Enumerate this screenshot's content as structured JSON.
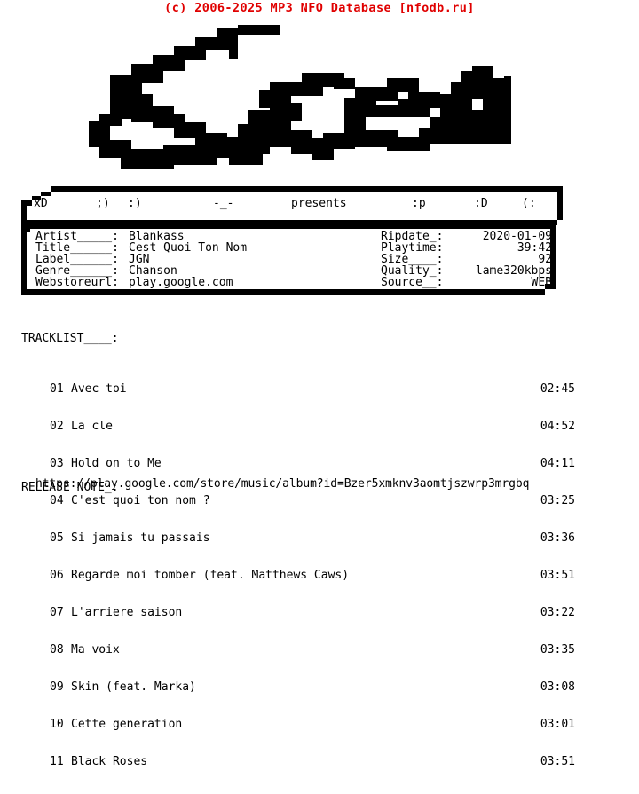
{
  "header": {
    "copyright": "(c) 2006-2025 MP3 NFO Database [nfodb.ru]",
    "copyright_color": "#e00000"
  },
  "logo": {
    "text": "Sceau",
    "style": "pixel-ascii-art",
    "color": "#000000"
  },
  "banner": {
    "slots": [
      "xD",
      ";)",
      ":)",
      "-_-",
      "presents",
      ":p",
      ":D",
      "(:"
    ]
  },
  "info": {
    "left": [
      {
        "key": "Artist_____:",
        "value": "Blankass"
      },
      {
        "key": "Title______:",
        "value": "Cest Quoi Ton Nom"
      },
      {
        "key": "Label______:",
        "value": "JGN"
      },
      {
        "key": "Genre______:",
        "value": "Chanson"
      },
      {
        "key": "Webstoreurl:",
        "value": "play.google.com"
      }
    ],
    "right": [
      {
        "key": "Ripdate_:",
        "value": "2020-01-09"
      },
      {
        "key": "Playtime:",
        "value": "39:42"
      },
      {
        "key": "Size____:",
        "value": "92"
      },
      {
        "key": "Quality_:",
        "value": "lame320kbps"
      },
      {
        "key": "Source__:",
        "value": "WEB"
      }
    ]
  },
  "tracklist": {
    "heading": "TRACKLIST____:",
    "tracks": [
      {
        "num": "01",
        "title": "Avec toi",
        "time": "02:45"
      },
      {
        "num": "02",
        "title": "La cle",
        "time": "04:52"
      },
      {
        "num": "03",
        "title": "Hold on to Me",
        "time": "04:11"
      },
      {
        "num": "04",
        "title": "C'est quoi ton nom ?",
        "time": "03:25"
      },
      {
        "num": "05",
        "title": "Si jamais tu passais",
        "time": "03:36"
      },
      {
        "num": "06",
        "title": "Regarde moi tomber (feat. Matthews Caws)",
        "time": "03:51"
      },
      {
        "num": "07",
        "title": "L'arriere saison",
        "time": "03:22"
      },
      {
        "num": "08",
        "title": "Ma voix",
        "time": "03:35"
      },
      {
        "num": "09",
        "title": "Skin (feat. Marka)",
        "time": "03:08"
      },
      {
        "num": "10",
        "title": "Cette generation",
        "time": "03:01"
      },
      {
        "num": "11",
        "title": "Black Roses",
        "time": "03:51"
      }
    ]
  },
  "release_note": {
    "heading": "RELEASE NOTE_:",
    "url": "https://play.google.com/store/music/album?id=Bzer5xmknv3aomtjszwrp3mrgbq"
  }
}
